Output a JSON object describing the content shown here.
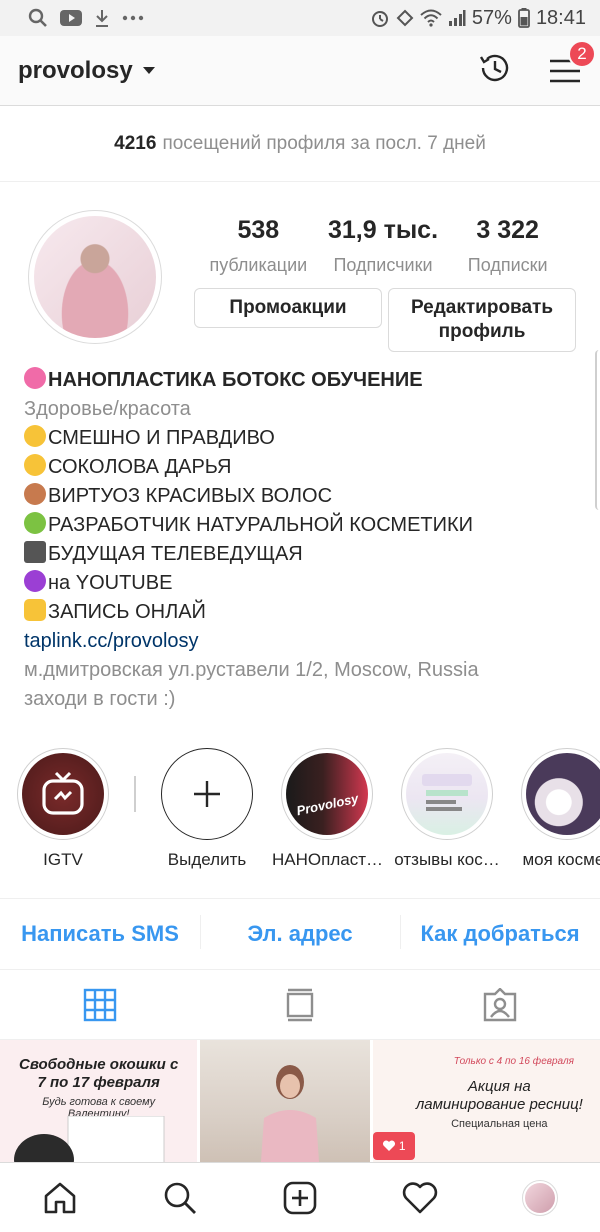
{
  "status_bar": {
    "battery": "57%",
    "time": "18:41",
    "icons_left": [
      "search-icon",
      "youtube-icon",
      "download-icon",
      "more-icon"
    ],
    "icons_right": [
      "alarm-icon",
      "data-icon",
      "wifi-icon",
      "signal-icon",
      "battery-icon"
    ]
  },
  "header": {
    "username": "provolosy",
    "badge_count": "2"
  },
  "visits": {
    "count": "4216",
    "text": "посещений профиля за посл. 7 дней"
  },
  "stats": [
    {
      "value": "538",
      "label": "публикации"
    },
    {
      "value": "31,9 тыс.",
      "label": "Подписчики"
    },
    {
      "value": "3 322",
      "label": "Подписки"
    }
  ],
  "buttons": {
    "promo": "Промоакции",
    "edit": "Редактировать профиль"
  },
  "bio": {
    "name": "НАНОПЛАСТИКА БОТОКС ОБУЧЕНИЕ",
    "category": "Здоровье/красота",
    "lines": [
      "СМЕШНО И ПРАВДИВО",
      "СОКОЛОВА ДАРЬЯ",
      "ВИРТУОЗ КРАСИВЫХ ВОЛОС",
      "РАЗРАБОТЧИК НАТУРАЛЬНОЙ КОСМЕТИКИ",
      "БУДУЩАЯ ТЕЛЕВЕДУЩАЯ",
      "на YOUTUBE",
      "ЗАПИСЬ ОНЛАЙ"
    ],
    "link": "taplink.cc/provolosy",
    "address": "м.дмитровская ул.руставели 1/2, Moscow, Russia",
    "tagline": "заходи в гости :)"
  },
  "highlights": [
    {
      "label": "IGTV"
    },
    {
      "label": "Выделить"
    },
    {
      "label": "НАНОпласт…",
      "text": "Provolosy"
    },
    {
      "label": "отзывы кос…"
    },
    {
      "label": "моя космет"
    }
  ],
  "contact": {
    "sms": "Написать SMS",
    "email": "Эл. адрес",
    "directions": "Как добраться"
  },
  "grid": [
    {
      "title": "Свободные окошки с 7 по 17 февраля",
      "subtitle": "Будь готова к своему Валентину!"
    },
    {
      "title": ""
    },
    {
      "title": "Акция на ламинирование ресниц!",
      "subtitle": "Специальная цена",
      "note": "Только с 4 по 16 февраля",
      "likes": "1"
    }
  ],
  "colors": {
    "accent": "#3897f0",
    "badge": "#ed4956",
    "text_primary": "#262626",
    "text_secondary": "#8e8e8e"
  }
}
